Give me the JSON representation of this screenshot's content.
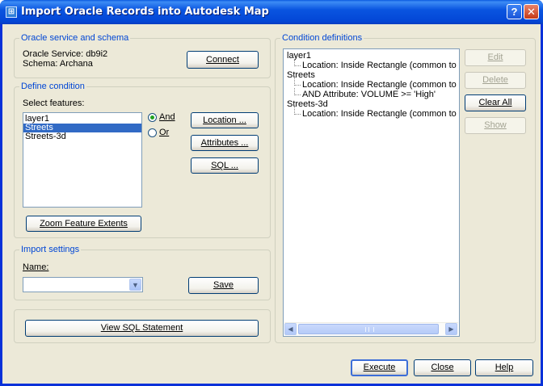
{
  "window": {
    "title": "Import Oracle Records into Autodesk Map",
    "icon": "map-app-icon",
    "help_glyph": "?",
    "close_glyph": "✕"
  },
  "oracle_group": {
    "label": "Oracle service and schema",
    "service_text": "Oracle Service: db9i2",
    "schema_text": "Schema: Archana",
    "connect_label": "Connect"
  },
  "define_group": {
    "label": "Define condition",
    "select_features_label": "Select features:",
    "features": [
      {
        "label": "layer1",
        "selected": false
      },
      {
        "label": "Streets",
        "selected": true
      },
      {
        "label": "Streets-3d",
        "selected": false
      }
    ],
    "radio_and": {
      "label": "And",
      "checked": true
    },
    "radio_or": {
      "label": "Or",
      "checked": false
    },
    "location_label": "Location ...",
    "attributes_label": "Attributes ...",
    "sql_label": "SQL ...",
    "zoom_label": "Zoom Feature Extents"
  },
  "import_group": {
    "label": "Import settings",
    "name_label": "Name:",
    "name_value": "",
    "save_label": "Save"
  },
  "view_sql_label": "View SQL Statement",
  "conditions_group": {
    "label": "Condition definitions",
    "tree": [
      {
        "label": "layer1",
        "children": [
          "Location: Inside Rectangle (common to lay"
        ]
      },
      {
        "label": "Streets",
        "children": [
          "Location: Inside Rectangle (common to lay",
          "AND Attribute: VOLUME >= 'High'"
        ]
      },
      {
        "label": "Streets-3d",
        "children": [
          "Location: Inside Rectangle (common to lay"
        ]
      }
    ],
    "scroll_left_glyph": "◀",
    "scroll_right_glyph": "▶"
  },
  "side_buttons": {
    "edit": {
      "label": "Edit",
      "enabled": false
    },
    "delete": {
      "label": "Delete",
      "enabled": false
    },
    "clear_all": {
      "label": "Clear All",
      "enabled": true
    },
    "show": {
      "label": "Show",
      "enabled": false
    }
  },
  "footer": {
    "execute_label": "Execute",
    "close_label": "Close",
    "help_label": "Help"
  },
  "colors": {
    "titlebar": "#0a55e0",
    "group_label": "#0046d5",
    "selection": "#316ac5",
    "dialog_bg": "#ece9d8"
  }
}
